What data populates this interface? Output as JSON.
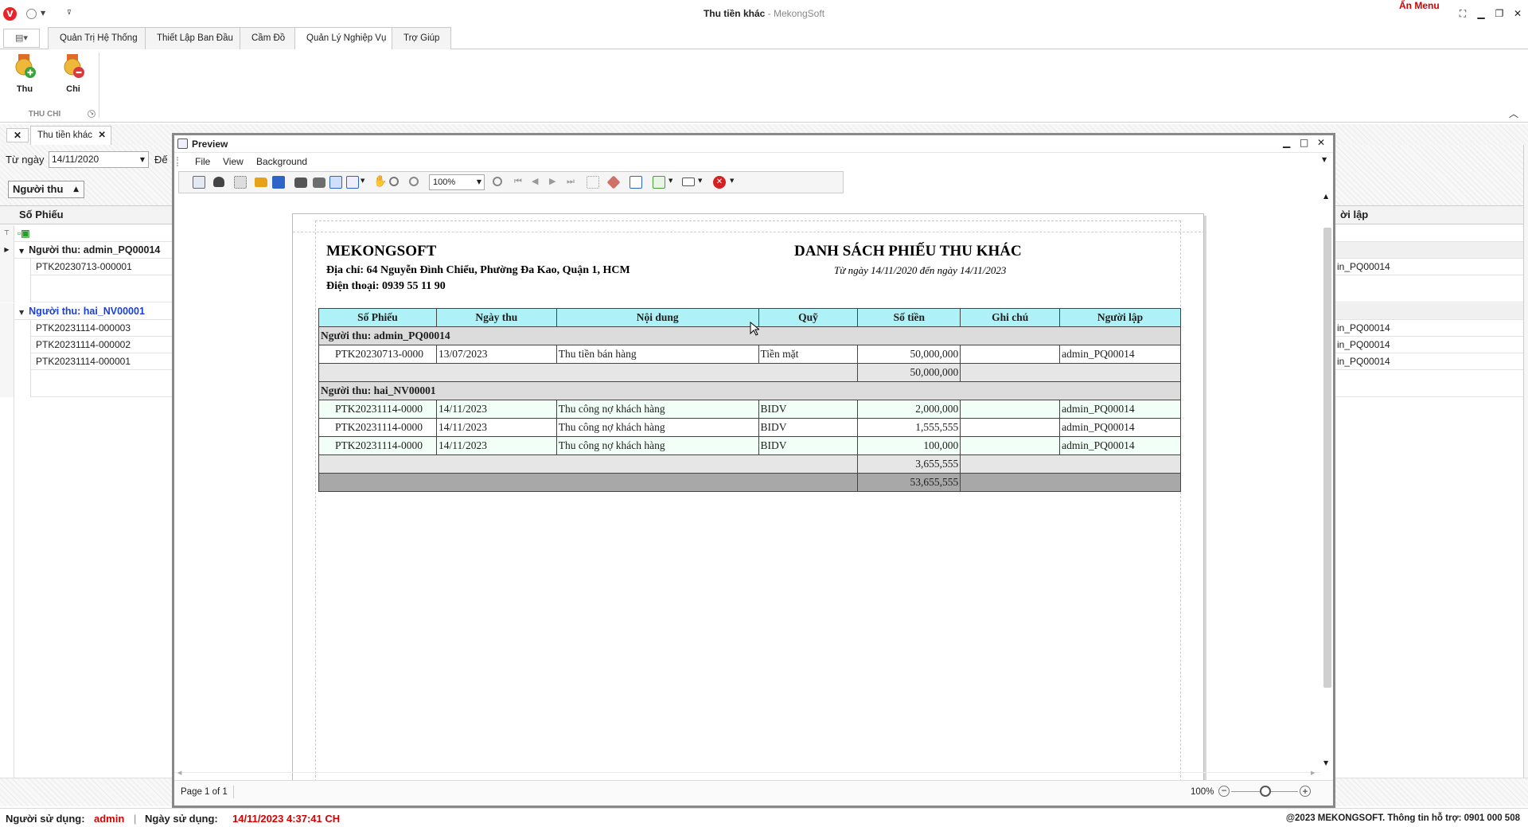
{
  "window": {
    "title": "Thu tiền khác",
    "app_name": "MekongSoft",
    "title_sep": " - ",
    "hide_menu": "Ẩn Menu",
    "logo_letter": "V"
  },
  "ribbon": {
    "tabs": [
      "Quản Trị Hệ Thống",
      "Thiết Lập Ban Đầu",
      "Cầm Đồ",
      "Quản Lý Nghiệp Vụ",
      "Trợ Giúp"
    ],
    "active_tab": "Quản Lý Nghiệp Vụ",
    "buttons": [
      {
        "label": "Thu",
        "icon": "money-in-icon"
      },
      {
        "label": "Chi",
        "icon": "money-out-icon"
      }
    ],
    "group_label": "THU CHI"
  },
  "doc_tab": {
    "label": "Thu tiền khác",
    "close": "✕"
  },
  "filter": {
    "from_label": "Từ ngày",
    "from_value": "14/11/2020",
    "to_label": "Đế"
  },
  "grid": {
    "group_by": "Người thu",
    "column": "Số Phiếu",
    "right_column": "ời lập",
    "groups": [
      {
        "label": "Người thu: admin_PQ00014",
        "rows": [
          "PTK20230713-000001"
        ],
        "creators": [
          "in_PQ00014"
        ]
      },
      {
        "label": "Người thu: hai_NV00001",
        "rows": [
          "PTK20231114-000003",
          "PTK20231114-000002",
          "PTK20231114-000001"
        ],
        "creators": [
          "in_PQ00014",
          "in_PQ00014",
          "in_PQ00014"
        ]
      }
    ]
  },
  "preview": {
    "title": "Preview",
    "menu": [
      "File",
      "View",
      "Background"
    ],
    "zoom": "100%",
    "page_info": "Page 1 of 1",
    "zoom_status": "100%"
  },
  "report": {
    "company": "MEKONGSOFT",
    "address": "Địa chỉ: 64 Nguyễn Đình Chiểu, Phường Đa Kao, Quận 1, HCM",
    "phone": "Điện thoại: 0939 55 11 90",
    "title": "DANH SÁCH PHIẾU THU KHÁC",
    "date_range": "Từ ngày 14/11/2020 đến ngày 14/11/2023",
    "columns": [
      "Số Phiếu",
      "Ngày thu",
      "Nội dung",
      "Quỹ",
      "Số tiền",
      "Ghi chú",
      "Người lập"
    ],
    "groups": [
      {
        "label": "Người thu: admin_PQ00014",
        "rows": [
          {
            "so_phieu": "PTK20230713-0000",
            "ngay": "13/07/2023",
            "noi_dung": "Thu tiền bán hàng",
            "quy": "Tiền mặt",
            "so_tien": "50,000,000",
            "ghi_chu": "",
            "nguoi_lap": "admin_PQ00014"
          }
        ],
        "subtotal": "50,000,000"
      },
      {
        "label": "Người thu: hai_NV00001",
        "rows": [
          {
            "so_phieu": "PTK20231114-0000",
            "ngay": "14/11/2023",
            "noi_dung": "Thu công nợ khách hàng",
            "quy": "BIDV",
            "so_tien": "2,000,000",
            "ghi_chu": "",
            "nguoi_lap": "admin_PQ00014"
          },
          {
            "so_phieu": "PTK20231114-0000",
            "ngay": "14/11/2023",
            "noi_dung": "Thu công nợ khách hàng",
            "quy": "BIDV",
            "so_tien": "1,555,555",
            "ghi_chu": "",
            "nguoi_lap": "admin_PQ00014"
          },
          {
            "so_phieu": "PTK20231114-0000",
            "ngay": "14/11/2023",
            "noi_dung": "Thu công nợ khách hàng",
            "quy": "BIDV",
            "so_tien": "100,000",
            "ghi_chu": "",
            "nguoi_lap": "admin_PQ00014"
          }
        ],
        "subtotal": "3,655,555"
      }
    ],
    "grand_total": "53,655,555"
  },
  "status": {
    "user_label": "Người sử dụng:",
    "user": "admin",
    "sep": "|",
    "date_label": "Ngày sử dụng:",
    "date": "14/11/2023 4:37:41 CH",
    "copyright": "@2023 MEKONGSOFT. Thông tin hỗ trợ: 0901 000 508"
  },
  "colors": {
    "accent_red": "#d40000",
    "header_cyan": "#aef1f7",
    "group_link_blue": "#1a3fd6"
  }
}
